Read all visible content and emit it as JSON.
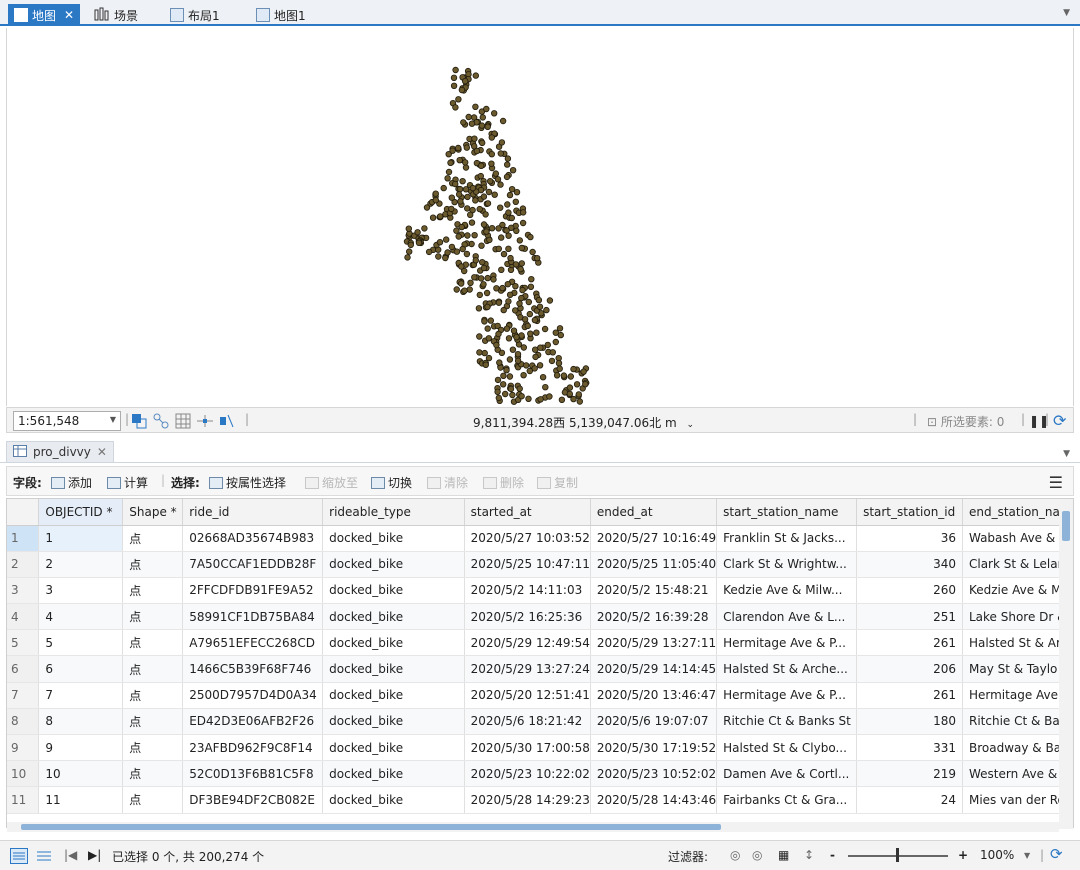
{
  "tabs": [
    {
      "label": "地图",
      "active": true,
      "closable": true,
      "icon": "map-icon"
    },
    {
      "label": "场景",
      "active": false,
      "icon": "scene-icon"
    },
    {
      "label": "布局1",
      "active": false,
      "icon": "layout-icon"
    },
    {
      "label": "地图1",
      "active": false,
      "icon": "map-icon"
    }
  ],
  "map": {
    "scale": "1:561,548",
    "coordinates": "9,811,394.28西 5,139,047.06北 m",
    "selected_features_label": "所选要素: 0",
    "point_color": "#6b5a2e"
  },
  "table_pane": {
    "tab_label": "pro_divvy"
  },
  "toolbar": {
    "fields_label": "字段:",
    "add_label": "添加",
    "calc_label": "计算",
    "selection_label": "选择:",
    "select_by_attr_label": "按属性选择",
    "zoom_to_label": "缩放至",
    "switch_label": "切换",
    "clear_label": "清除",
    "delete_label": "删除",
    "copy_label": "复制"
  },
  "columns": [
    "OBJECTID *",
    "Shape *",
    "ride_id",
    "rideable_type",
    "started_at",
    "ended_at",
    "start_station_name",
    "start_station_id",
    "end_station_na"
  ],
  "rows": [
    {
      "rn": "1",
      "objectid": "1",
      "shape": "点",
      "ride_id": "02668AD35674B983",
      "type": "docked_bike",
      "started": "2020/5/27 10:03:52",
      "ended": "2020/5/27 10:16:49",
      "start_name": "Franklin St & Jacks...",
      "start_id": "36",
      "end_name": "Wabash Ave &"
    },
    {
      "rn": "2",
      "objectid": "2",
      "shape": "点",
      "ride_id": "7A50CCAF1EDDB28F",
      "type": "docked_bike",
      "started": "2020/5/25 10:47:11",
      "ended": "2020/5/25 11:05:40",
      "start_name": "Clark St & Wrightw...",
      "start_id": "340",
      "end_name": "Clark St & Lelar"
    },
    {
      "rn": "3",
      "objectid": "3",
      "shape": "点",
      "ride_id": "2FFCDFDB91FE9A52",
      "type": "docked_bike",
      "started": "2020/5/2 14:11:03",
      "ended": "2020/5/2 15:48:21",
      "start_name": "Kedzie Ave & Milw...",
      "start_id": "260",
      "end_name": "Kedzie Ave & M"
    },
    {
      "rn": "4",
      "objectid": "4",
      "shape": "点",
      "ride_id": "58991CF1DB75BA84",
      "type": "docked_bike",
      "started": "2020/5/2 16:25:36",
      "ended": "2020/5/2 16:39:28",
      "start_name": "Clarendon Ave & L...",
      "start_id": "251",
      "end_name": "Lake Shore Dr &"
    },
    {
      "rn": "5",
      "objectid": "5",
      "shape": "点",
      "ride_id": "A79651EFECC268CD",
      "type": "docked_bike",
      "started": "2020/5/29 12:49:54",
      "ended": "2020/5/29 13:27:11",
      "start_name": "Hermitage Ave & P...",
      "start_id": "261",
      "end_name": "Halsted St & Ar"
    },
    {
      "rn": "6",
      "objectid": "6",
      "shape": "点",
      "ride_id": "1466C5B39F68F746",
      "type": "docked_bike",
      "started": "2020/5/29 13:27:24",
      "ended": "2020/5/29 14:14:45",
      "start_name": "Halsted St & Arche...",
      "start_id": "206",
      "end_name": "May St & Taylo"
    },
    {
      "rn": "7",
      "objectid": "7",
      "shape": "点",
      "ride_id": "2500D7957D4D0A34",
      "type": "docked_bike",
      "started": "2020/5/20 12:51:41",
      "ended": "2020/5/20 13:46:47",
      "start_name": "Hermitage Ave & P...",
      "start_id": "261",
      "end_name": "Hermitage Ave"
    },
    {
      "rn": "8",
      "objectid": "8",
      "shape": "点",
      "ride_id": "ED42D3E06AFB2F26",
      "type": "docked_bike",
      "started": "2020/5/6 18:21:42",
      "ended": "2020/5/6 19:07:07",
      "start_name": "Ritchie Ct & Banks St",
      "start_id": "180",
      "end_name": "Ritchie Ct & Ba"
    },
    {
      "rn": "9",
      "objectid": "9",
      "shape": "点",
      "ride_id": "23AFBD962F9C8F14",
      "type": "docked_bike",
      "started": "2020/5/30 17:00:58",
      "ended": "2020/5/30 17:19:52",
      "start_name": "Halsted St & Clybo...",
      "start_id": "331",
      "end_name": "Broadway & Ba"
    },
    {
      "rn": "10",
      "objectid": "10",
      "shape": "点",
      "ride_id": "52C0D13F6B81C5F8",
      "type": "docked_bike",
      "started": "2020/5/23 10:22:02",
      "ended": "2020/5/23 10:52:02",
      "start_name": "Damen Ave & Cortl...",
      "start_id": "219",
      "end_name": "Western Ave &"
    },
    {
      "rn": "11",
      "objectid": "11",
      "shape": "点",
      "ride_id": "DF3BE94DF2CB082E",
      "type": "docked_bike",
      "started": "2020/5/28 14:29:23",
      "ended": "2020/5/28 14:43:46",
      "start_name": "Fairbanks Ct & Gra...",
      "start_id": "24",
      "end_name": "Mies van der Ro"
    }
  ],
  "status": {
    "selection_text": "已选择 0 个, 共 200,274 个",
    "filter_label": "过滤器:",
    "zoom_level": "100%",
    "zoom_minus": "-",
    "zoom_plus": "+"
  }
}
